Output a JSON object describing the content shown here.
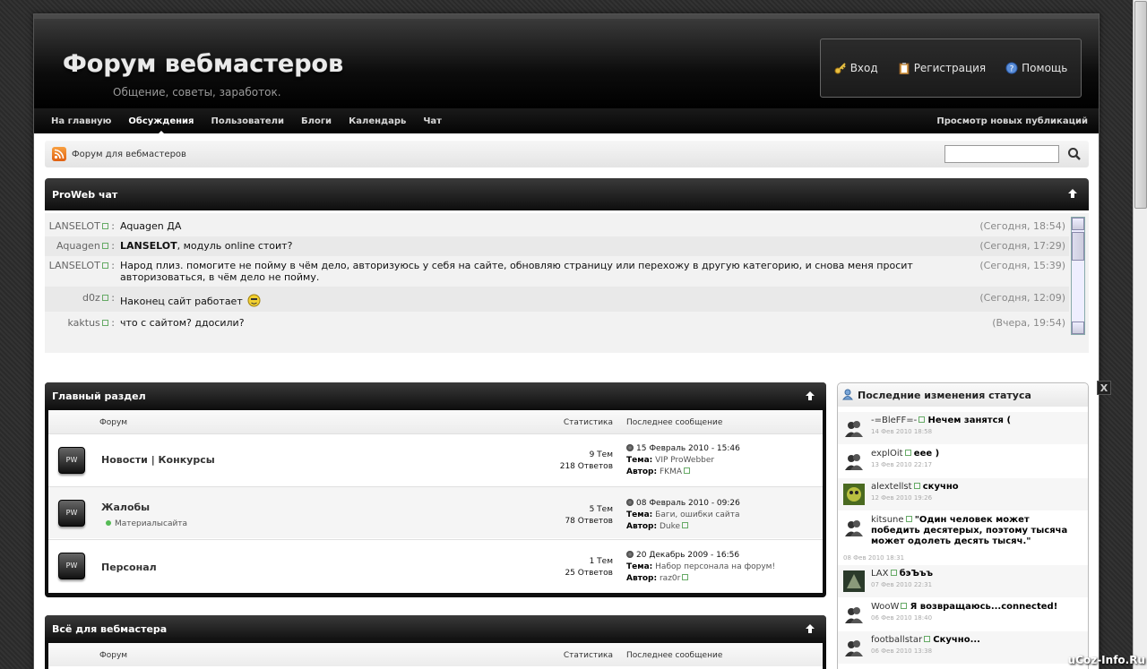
{
  "site": {
    "title": "Форум вебмастеров",
    "subtitle": "Общение, советы, заработок."
  },
  "userbox": {
    "login": "Вход",
    "register": "Регистрация",
    "help": "Помощь"
  },
  "nav": {
    "items": [
      "На главную",
      "Обсуждения",
      "Пользователи",
      "Блоги",
      "Календарь",
      "Чат"
    ],
    "active": "Обсуждения",
    "right": "Просмотр новых публикаций"
  },
  "breadcrumb": {
    "text": "Форум для вебмастеров"
  },
  "chat": {
    "title": "ProWeb чат",
    "messages": [
      {
        "user": "LANSELOT",
        "text": "Aquagen ДА",
        "time": "(Сегодня, 18:54)"
      },
      {
        "user": "Aquagen",
        "addressee": "LANSELOT",
        "text": ", модуль online стоит?",
        "time": "(Сегодня, 17:29)"
      },
      {
        "user": "LANSELOT",
        "text": "Народ плиз. помогите не пойму в чём дело, авторизуюсь у себя на сайте, обновляю страницу или перехожу в другую категорию, и снова меня просит авторизоваться, в чём дело не пойму.",
        "time": "(Сегодня, 15:39)"
      },
      {
        "user": "d0z",
        "text": "Наконец сайт работает",
        "time": "(Сегодня, 12:09)"
      },
      {
        "user": "kaktus",
        "text": "что с сайтом? ддосили?",
        "time": "(Вчера, 19:54)"
      }
    ]
  },
  "main_section": {
    "title": "Главный раздел",
    "col_forum": "Форум",
    "col_stats": "Статистика",
    "col_last": "Последнее сообщение",
    "icon_label": "PW",
    "topic_label": "Тема:",
    "author_label": "Автор:",
    "forums": [
      {
        "name": "Новости | Конкурсы",
        "topics": "9 Тем",
        "replies": "218 Ответов",
        "date": "15 Февраль 2010 - 15:46",
        "topic": "VIP ProWebber",
        "author": "FKMA"
      },
      {
        "name": "Жалобы",
        "sub": "Материалысайта",
        "topics": "5 Тем",
        "replies": "78 Ответов",
        "date": "08 Февраль 2010 - 09:26",
        "topic": "Баги, ошибки сайта",
        "author": "Duke"
      },
      {
        "name": "Персонал",
        "topics": "1 Тем",
        "replies": "25 Ответов",
        "date": "20 Декабрь 2009 - 16:56",
        "topic": "Набор персонала на форум!",
        "author": "raz0r"
      }
    ]
  },
  "webmaster_section": {
    "title": "Всё для вебмастера",
    "col_forum": "Форум",
    "col_stats": "Статистика",
    "col_last": "Последнее сообщение"
  },
  "status": {
    "title": "Последние изменения статуса",
    "items": [
      {
        "user": "-=BleFF=-",
        "text": "Нечем занятся (",
        "date": "14 Фев 2010 18:58"
      },
      {
        "user": "explOit",
        "text": "еее )",
        "date": "13 Фев 2010 22:17"
      },
      {
        "user": "alextellst",
        "text": "скучно",
        "date": "12 Фев 2010 19:26"
      },
      {
        "user": "kitsune",
        "text": "\"Один человек может победить десятерых, поэтому тысяча может одолеть десять тысяч.\"",
        "date": "08 Фев 2010 18:31"
      },
      {
        "user": "LAX",
        "text": "бэЪъъ",
        "date": "07 Фев 2010 22:31"
      },
      {
        "user": "WooW",
        "text": "Я возвращаюсь...connected!",
        "date": "06 Фев 2010 18:40"
      },
      {
        "user": "footballstar",
        "text": "Скучно...",
        "date": "06 Фев 2010 13:38"
      }
    ]
  },
  "close_label": "X",
  "watermark": "uCoz-Info.Ru",
  "colors": {
    "header_bg": "#0c0c0c",
    "accent": "#3a3a3a",
    "link_green": "#66aa66"
  }
}
